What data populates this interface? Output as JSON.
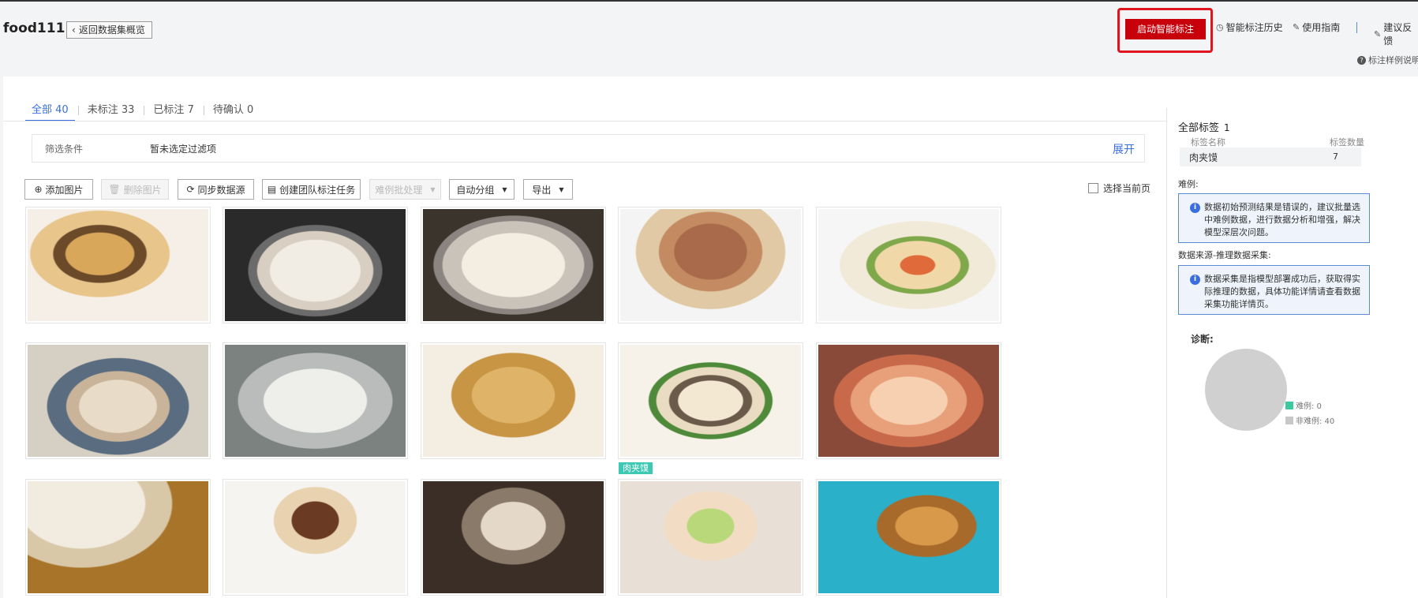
{
  "header": {
    "dataset_name": "food111",
    "back_label": "返回数据集概览",
    "smart_label_button": "启动智能标注",
    "links": {
      "history": "智能标注历史",
      "guide": "使用指南",
      "feedback": "建议反馈"
    },
    "example_desc": "标注样例说明"
  },
  "tabs": [
    {
      "label": "全部",
      "count": "40"
    },
    {
      "label": "未标注",
      "count": "33"
    },
    {
      "label": "已标注",
      "count": "7"
    },
    {
      "label": "待确认",
      "count": "0"
    }
  ],
  "filter": {
    "label": "筛选条件",
    "value": "暂未选定过滤项",
    "expand": "展开"
  },
  "toolbar": {
    "add_image": "添加图片",
    "delete_image": "删除图片",
    "sync_source": "同步数据源",
    "create_team_task": "创建团队标注任务",
    "hard_example": "难例批处理",
    "auto_group": "自动分组",
    "export": "导出",
    "select_page": "选择当前页"
  },
  "image_tags": {
    "card_9": "肉夹馍"
  },
  "right_panel": {
    "all_labels_title": "全部标签",
    "all_labels_count": "1",
    "col_name": "标签名称",
    "col_count": "标签数量",
    "labels": [
      {
        "name": "肉夹馍",
        "count": "7"
      }
    ],
    "hard_example_title": "难例:",
    "hard_example_info": "数据初始预测结果是错误的，建议批量选中难例数据，进行数据分析和增强，解决模型深层次问题。",
    "source_title": "数据来源-推理数据采集:",
    "source_info": "数据采集是指模型部署成功后，获取得实际推理的数据，具体功能详情请查看数据采集功能详情页。",
    "diagnosis_title": "诊断:",
    "legend": [
      {
        "label": "难例: 0",
        "color": "#3cc9a0"
      },
      {
        "label": "非难例: 40",
        "color": "#c8c8c8"
      }
    ]
  },
  "colors": {
    "accent": "#3a6ee0",
    "primary_button": "#c7000b",
    "highlight_frame": "#e0141e",
    "tag": "#3cc9b4"
  }
}
